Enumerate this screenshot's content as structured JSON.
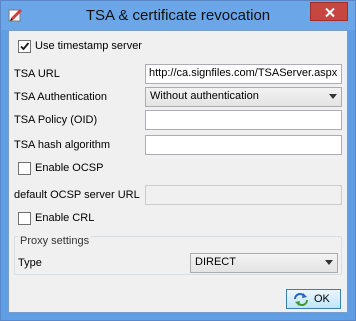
{
  "window": {
    "title": "TSA & certificate revocation"
  },
  "timestamp": {
    "checkbox_label": "Use timestamp server",
    "checked": true
  },
  "tsa_url": {
    "label": "TSA URL",
    "value": "http://ca.signfiles.com/TSAServer.aspx"
  },
  "tsa_auth": {
    "label": "TSA Authentication",
    "value": "Without authentication"
  },
  "tsa_policy": {
    "label": "TSA Policy (OID)",
    "value": ""
  },
  "tsa_hash": {
    "label": "TSA hash algorithm",
    "value": ""
  },
  "ocsp": {
    "checkbox_label": "Enable OCSP",
    "checked": false,
    "server_label": "default OCSP server URL",
    "server_value": ""
  },
  "crl": {
    "checkbox_label": "Enable CRL",
    "checked": false
  },
  "proxy": {
    "group_label": "Proxy settings",
    "type_label": "Type",
    "type_value": "DIRECT"
  },
  "buttons": {
    "ok_label": "OK"
  },
  "colors": {
    "title_bar": "#6aa6e8",
    "close_button": "#c7463f",
    "dialog_bg": "#f0f0f0"
  }
}
